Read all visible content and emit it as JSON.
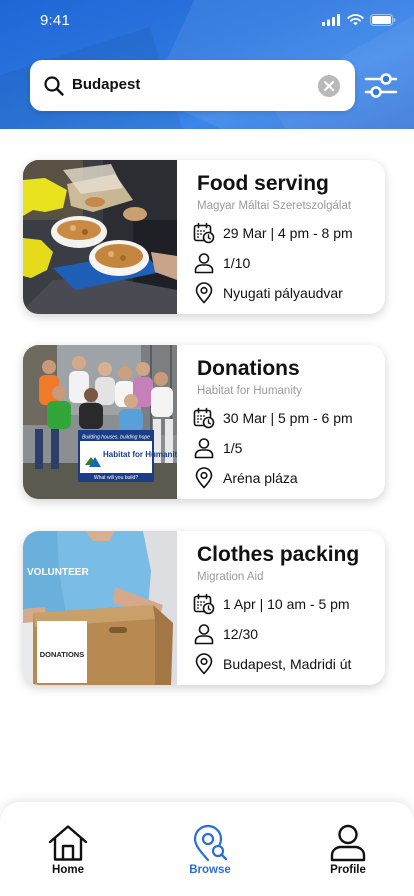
{
  "status_bar": {
    "time": "9:41"
  },
  "search": {
    "value": "Budapest"
  },
  "events": [
    {
      "title": "Food serving",
      "organization": "Magyar Máltai Szeretszolgálat",
      "date_time": "29 Mar | 4 pm - 8 pm",
      "spots": "1/10",
      "location": "Nyugati pályaudvar"
    },
    {
      "title": "Donations",
      "organization": "Habitat for Humanity",
      "date_time": "30 Mar | 5 pm - 6 pm",
      "spots": "1/5",
      "location": "Aréna pláza",
      "photo_sign": {
        "slogan": "Building houses, building hope",
        "brand": "Habitat for Humanity",
        "question": "What will you build?"
      }
    },
    {
      "title": "Clothes packing",
      "organization": "Migration Aid",
      "date_time": "1 Apr | 10 am - 5 pm",
      "spots": "12/30",
      "location": "Budapest, Madridi út",
      "photo_text": {
        "shirt": "VOLUNTEER",
        "box": "DONATIONS"
      }
    }
  ],
  "nav": {
    "items": [
      {
        "label": "Home",
        "icon": "home-icon",
        "active": false
      },
      {
        "label": "Browse",
        "icon": "location-search-icon",
        "active": true
      },
      {
        "label": "Profile",
        "icon": "user-icon",
        "active": false
      }
    ]
  },
  "colors": {
    "header_blue": "#2d78e0",
    "accent": "#2b6fd6",
    "text": "#111111",
    "muted": "#9a9a9a"
  }
}
